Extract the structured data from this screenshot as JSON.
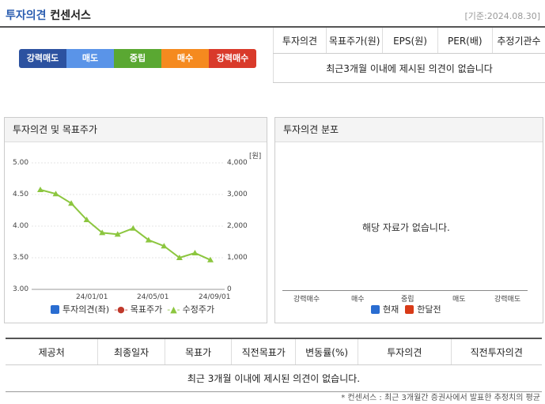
{
  "header": {
    "title_a": "투자의견",
    "title_b": "컨센서스",
    "basis": "[기준:2024.08.30]"
  },
  "opinion_scale": [
    {
      "label": "강력매도",
      "color": "#2c52a0"
    },
    {
      "label": "매도",
      "color": "#5a94e8"
    },
    {
      "label": "중립",
      "color": "#5aa832"
    },
    {
      "label": "매수",
      "color": "#f58a1f"
    },
    {
      "label": "강력매수",
      "color": "#d93a2a"
    }
  ],
  "consensus_table": {
    "headers": [
      "투자의견",
      "목표주가(원)",
      "EPS(원)",
      "PER(배)",
      "추정기관수"
    ],
    "empty_message": "최근3개월 이내에 제시된 의견이 없습니다"
  },
  "left_panel": {
    "title": "투자의견 및 목표주가",
    "unit": "[원]",
    "legend": [
      "투자의견(좌)",
      "목표주가",
      "수정주가"
    ],
    "legend_colors": [
      "#2a6dd1",
      "#c0392b",
      "#8cc63f"
    ]
  },
  "right_panel": {
    "title": "투자의견 분포",
    "empty_message": "해당 자료가 없습니다.",
    "categories": [
      "강력매수",
      "매수",
      "중립",
      "매도",
      "강력매도"
    ],
    "legend": [
      "현재",
      "한달전"
    ],
    "legend_colors": [
      "#2a6dd1",
      "#d83a17"
    ]
  },
  "chart_data": {
    "type": "line",
    "title": "투자의견 및 목표주가",
    "x_ticks": [
      "24/01/01",
      "24/05/01",
      "24/09/01"
    ],
    "y_left": {
      "ticks": [
        "5.00",
        "4.50",
        "4.00",
        "3.50",
        "3.00"
      ],
      "range": [
        3,
        5
      ]
    },
    "y_right": {
      "ticks": [
        "4,000",
        "3,000",
        "2,000",
        "1,000",
        "0"
      ],
      "range": [
        0,
        4000
      ],
      "label": "[원]"
    },
    "series": [
      {
        "name": "수정주가",
        "color": "#8cc63f",
        "x": [
          "2023-09",
          "2023-10",
          "2023-11",
          "2023-12",
          "2024-01",
          "2024-02",
          "2024-03",
          "2024-04",
          "2024-05",
          "2024-06",
          "2024-07",
          "2024-08"
        ],
        "y": [
          3150,
          3020,
          2720,
          2200,
          1790,
          1740,
          1930,
          1560,
          1370,
          1000,
          1150,
          930
        ]
      }
    ]
  },
  "providers_table": {
    "headers": [
      "제공처",
      "최종일자",
      "목표가",
      "직전목표가",
      "변동률(%)",
      "투자의견",
      "직전투자의견"
    ],
    "empty_message": "최근 3개월 이내에 제시된 의견이 없습니다."
  },
  "footnote": "* 컨센서스 : 최근 3개월간 증권사에서 발표한 추정치의 평균"
}
